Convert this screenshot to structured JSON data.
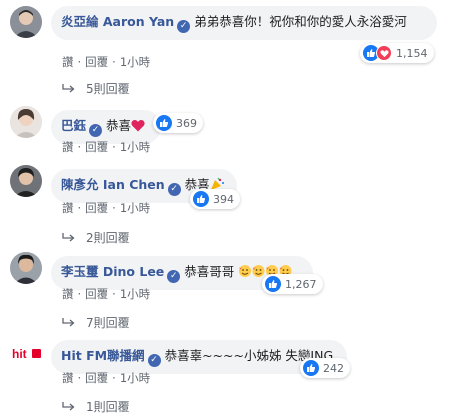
{
  "comments": [
    {
      "name": "炎亞綸 Aaron Yan",
      "text": "弟弟恭喜你！祝你和你的愛人永浴愛河",
      "reaction_count": "1,154",
      "like_label": "讚",
      "reply_label": "回覆",
      "time": "1小時",
      "replies_label": "5則回覆"
    },
    {
      "name": "巴鈺",
      "text": "恭喜",
      "reaction_count": "369",
      "like_label": "讚",
      "reply_label": "回覆",
      "time": "1小時"
    },
    {
      "name": "陳彥允 Ian Chen",
      "text": "恭喜",
      "reaction_count": "394",
      "like_label": "讚",
      "reply_label": "回覆",
      "time": "1小時",
      "replies_label": "2則回覆"
    },
    {
      "name": "李玉璽 Dino Lee",
      "text": "恭喜哥哥",
      "reaction_count": "1,267",
      "like_label": "讚",
      "reply_label": "回覆",
      "time": "1小時",
      "replies_label": "7則回覆"
    },
    {
      "name": "Hit FM聯播網",
      "text": "恭喜辜~~~~小姊姊 失戀ING",
      "reaction_count": "242",
      "like_label": "讚",
      "reply_label": "回覆",
      "time": "1小時",
      "replies_label": "1則回覆"
    }
  ],
  "logo": {
    "text": "hit"
  },
  "colors": {
    "name": "#385898",
    "bubble": "#f2f3f5",
    "like": "#1877f2",
    "love": "#f33e58",
    "meta": "#606770"
  },
  "icons": {
    "verified": "verified-badge-icon",
    "like": "thumbs-up-icon",
    "love": "heart-icon",
    "reply": "reply-arrow-icon"
  }
}
